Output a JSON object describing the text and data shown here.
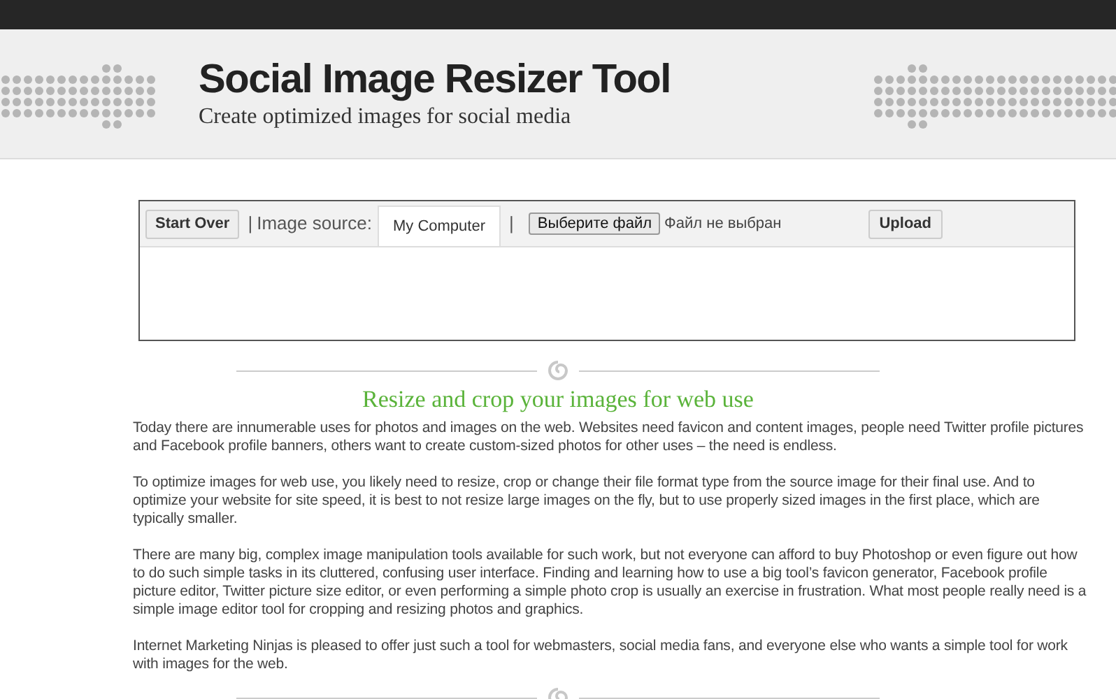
{
  "header": {
    "title": "Social Image Resizer Tool",
    "subtitle": "Create optimized images for social media"
  },
  "tool": {
    "start_over": "Start Over",
    "separator_1": "|",
    "source_label": "Image source:",
    "source_tabs": [
      {
        "label": "My Computer",
        "selected": true
      }
    ],
    "separator_2": "|",
    "file_button": "Выберите файл",
    "file_status": "Файл не выбран",
    "upload": "Upload"
  },
  "heading": "Resize and crop your images for web use",
  "paragraphs": [
    "Today there are innumerable uses for photos and images on the web. Websites need favicon and content images, people need Twitter profile pictures and Facebook profile banners, others want to create custom-sized photos for other uses – the need is endless.",
    "To optimize images for web use, you likely need to resize, crop or change their file format type from the source image for their final use. And to optimize your website for site speed, it is best to not resize large images on the fly, but to use properly sized images in the first place, which are typically smaller.",
    "There are many big, complex image manipulation tools available for such work, but not everyone can afford to buy Photoshop or even figure out how to do such simple tasks in its cluttered, confusing user interface. Finding and learning how to use a big tool’s favicon generator, Facebook profile picture editor, Twitter picture size editor, or even performing a simple photo crop is usually an exercise in frustration. What most people really need is a simple image editor tool for cropping and resizing photos and graphics.",
    "Internet Marketing Ninjas is pleased to offer just such a tool for webmasters, social media fans, and everyone else who wants a simple tool for work with images for the web."
  ]
}
